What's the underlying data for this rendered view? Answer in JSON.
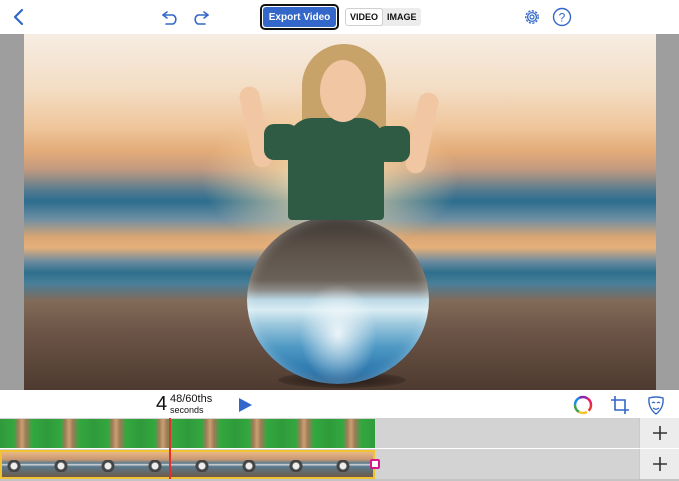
{
  "toolbar": {
    "icons": {
      "back": "chevron-left-icon",
      "undo": "undo-icon",
      "redo": "redo-icon",
      "settings": "gear-icon",
      "help": "help-icon"
    },
    "export_label": "Export Video",
    "modes": [
      "VIDEO",
      "IMAGE"
    ],
    "active_mode": "VIDEO",
    "help_glyph": "?"
  },
  "transport": {
    "seconds_whole": "4",
    "seconds_fraction": "48/60ths",
    "seconds_unit": "seconds",
    "icons": {
      "play": "play-icon",
      "color": "color-wheel-icon",
      "crop": "crop-icon",
      "mask": "mask-icon"
    }
  },
  "timeline": {
    "tracks": [
      {
        "name": "green-screen-track",
        "add_label": "+"
      },
      {
        "name": "background-track",
        "add_label": "+"
      }
    ]
  },
  "colors": {
    "accent": "#3367c9",
    "playhead": "#e0312b",
    "clip_border": "#f1c232",
    "trim_handle": "#d6168a"
  }
}
